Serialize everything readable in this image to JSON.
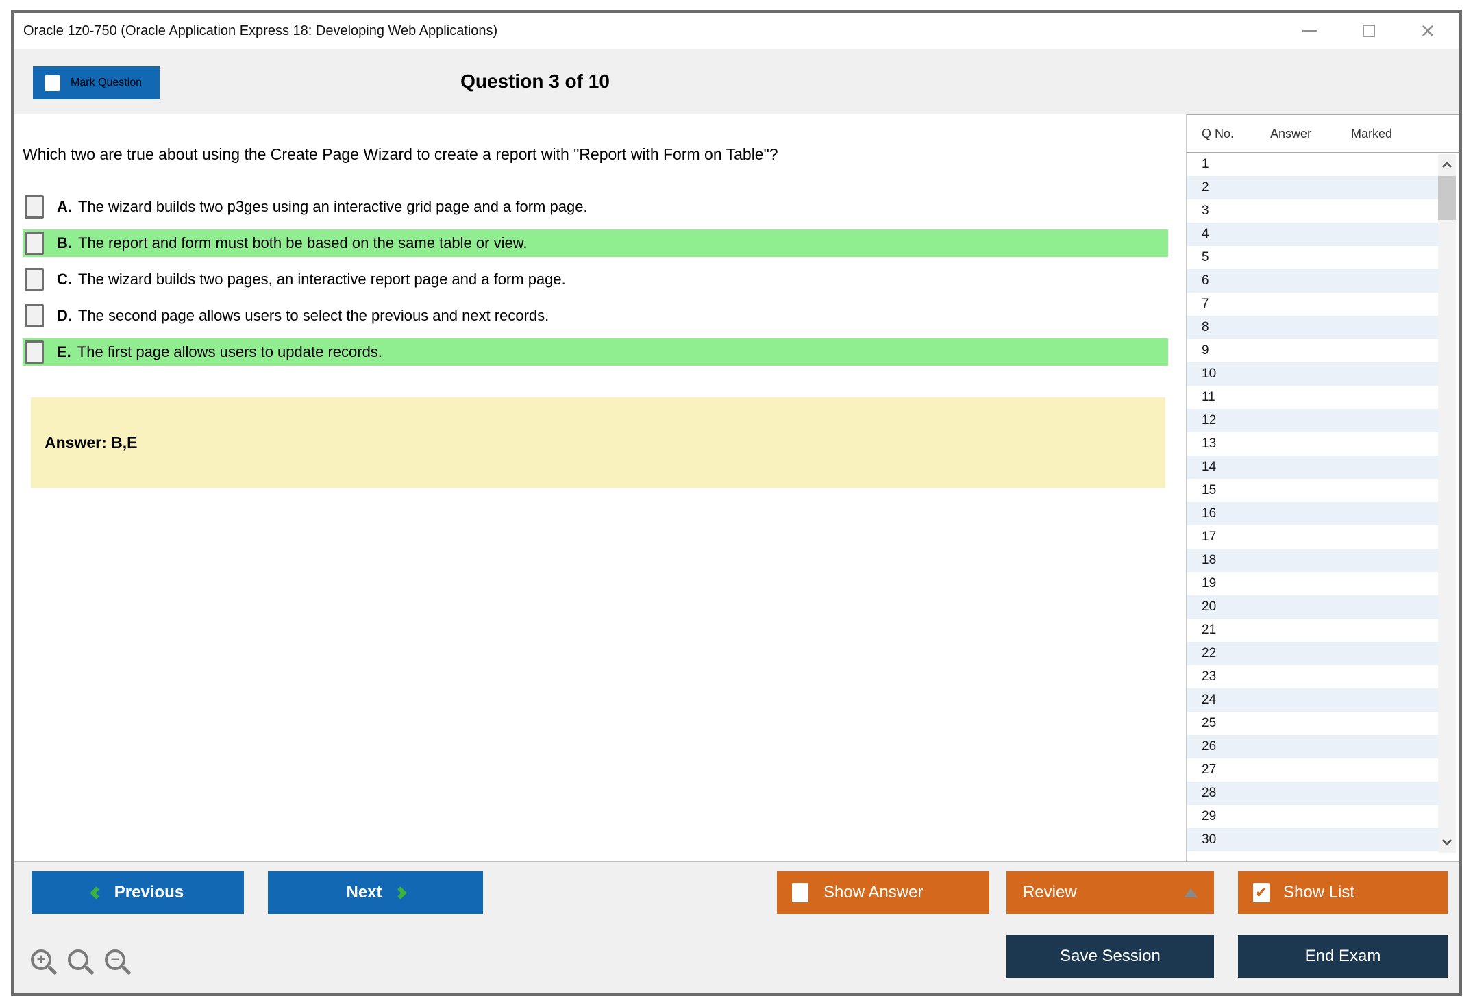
{
  "window": {
    "title": "Oracle 1z0-750 (Oracle Application Express 18: Developing Web Applications)",
    "controls": [
      "minimize",
      "maximize",
      "close"
    ]
  },
  "header": {
    "mark_question_label": "Mark Question",
    "question_counter": "Question 3 of 10"
  },
  "question": {
    "text": "Which two are true about using the Create Page Wizard to create a report with \"Report with Form on Table\"?",
    "options": [
      {
        "letter": "A.",
        "text": "The wizard builds two p3ges using an interactive grid page and a form page.",
        "highlighted": false
      },
      {
        "letter": "B.",
        "text": "The report and form must both be based on the same table or view.",
        "highlighted": true
      },
      {
        "letter": "C.",
        "text": "The wizard builds two pages, an interactive report page and a form page.",
        "highlighted": false
      },
      {
        "letter": "D.",
        "text": "The second page allows users to select the previous and next records.",
        "highlighted": false
      },
      {
        "letter": "E.",
        "text": "The first page allows users to update records.",
        "highlighted": true
      }
    ],
    "answer_label": "Answer: B,E"
  },
  "sidebar": {
    "columns": {
      "qno": "Q No.",
      "answer": "Answer",
      "marked": "Marked"
    },
    "question_numbers": [
      1,
      2,
      3,
      4,
      5,
      6,
      7,
      8,
      9,
      10,
      11,
      12,
      13,
      14,
      15,
      16,
      17,
      18,
      19,
      20,
      21,
      22,
      23,
      24,
      25,
      26,
      27,
      28,
      29,
      30
    ]
  },
  "toolbar": {
    "previous_label": "Previous",
    "next_label": "Next",
    "show_answer_label": "Show Answer",
    "review_label": "Review",
    "show_list_label": "Show List",
    "save_session_label": "Save Session",
    "end_exam_label": "End Exam",
    "show_list_check_glyph": "✔"
  },
  "icons": {
    "minimize": "minimize-icon",
    "maximize": "maximize-icon",
    "close": "close-icon",
    "previous": "chevron-left-icon",
    "next": "chevron-right-icon",
    "review": "triangle-up-icon",
    "scroll_up": "chevron-up-icon",
    "scroll_down": "chevron-down-icon",
    "zoom_in": "magnifier-plus-icon",
    "zoom_reset": "magnifier-icon",
    "zoom_out": "magnifier-minus-icon",
    "zoom_in_glyph": "+",
    "zoom_out_glyph": "−"
  },
  "colors": {
    "button_blue": "#1368b4",
    "button_orange": "#d4681c",
    "button_navy": "#1c3850",
    "chevron_green": "#3cb43c",
    "highlight_green": "#90ee90",
    "answer_yellow": "#faf2be",
    "row_stripe_blue": "#ebf1f8",
    "band_gray": "#f0f0f0"
  }
}
